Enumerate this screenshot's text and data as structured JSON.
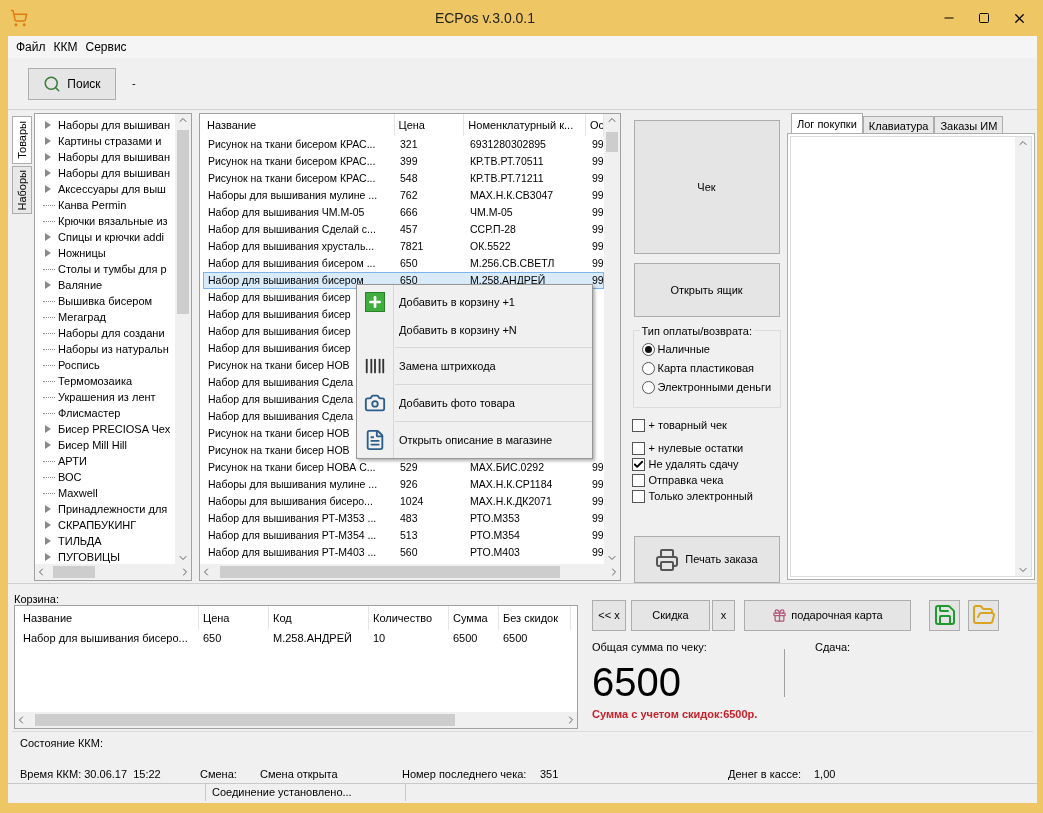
{
  "window": {
    "title": "ECPos v.3.0.0.1"
  },
  "menu": [
    "Файл",
    "ККМ",
    "Сервис"
  ],
  "toolbar": {
    "search_button": "Поиск",
    "status": "-"
  },
  "side_tabs": [
    {
      "label": "Товары",
      "selected": true
    },
    {
      "label": "Наборы",
      "selected": false
    }
  ],
  "tree": [
    {
      "label": "Наборы для вышиван",
      "kind": "branch"
    },
    {
      "label": "Картины стразами и",
      "kind": "branch"
    },
    {
      "label": "Наборы для вышиван",
      "kind": "branch"
    },
    {
      "label": "Наборы для вышиван",
      "kind": "branch"
    },
    {
      "label": "Аксессуары для выш",
      "kind": "branch"
    },
    {
      "label": "Канва Permin",
      "kind": "leaf"
    },
    {
      "label": "Крючки вязальные из",
      "kind": "leaf"
    },
    {
      "label": "Спицы и крючки addi",
      "kind": "branch"
    },
    {
      "label": "Ножницы",
      "kind": "branch"
    },
    {
      "label": "Столы и тумбы для р",
      "kind": "leaf"
    },
    {
      "label": "Валяние",
      "kind": "branch"
    },
    {
      "label": "Вышивка бисером",
      "kind": "leaf"
    },
    {
      "label": "Мегаград",
      "kind": "leaf"
    },
    {
      "label": "Наборы для создани",
      "kind": "leaf"
    },
    {
      "label": "Наборы из натуральн",
      "kind": "leaf"
    },
    {
      "label": "Роспись",
      "kind": "leaf"
    },
    {
      "label": "Термомозаика",
      "kind": "leaf"
    },
    {
      "label": "Украшения из лент",
      "kind": "leaf"
    },
    {
      "label": "Флисмастер",
      "kind": "leaf"
    },
    {
      "label": "Бисер PRECIOSA Чех",
      "kind": "branch"
    },
    {
      "label": "Бисер Mill Hill",
      "kind": "branch"
    },
    {
      "label": "АРТИ",
      "kind": "leaf"
    },
    {
      "label": "ВОС",
      "kind": "leaf"
    },
    {
      "label": "Maxwell",
      "kind": "leaf"
    },
    {
      "label": "Принадлежности для",
      "kind": "branch"
    },
    {
      "label": "СКРАПБУКИНГ",
      "kind": "branch"
    },
    {
      "label": "ТИЛЬДА",
      "kind": "branch"
    },
    {
      "label": "ПУГОВИЦЫ",
      "kind": "branch"
    }
  ],
  "products": {
    "columns": [
      "Название",
      "Цена",
      "Номенклатурный к...",
      "Ос"
    ],
    "rows": [
      {
        "name": "Рисунок на ткани бисером КРАС...",
        "price": "321",
        "code": "6931280302895",
        "stock": "99",
        "selected": false
      },
      {
        "name": "Рисунок на ткани бисером КРАС...",
        "price": "399",
        "code": "КР.ТВ.РТ.70511",
        "stock": "99",
        "selected": false
      },
      {
        "name": "Рисунок на ткани бисером КРАС...",
        "price": "548",
        "code": "КР.ТВ.РТ.71211",
        "stock": "99",
        "selected": false
      },
      {
        "name": "Наборы для вышивания мулине ...",
        "price": "762",
        "code": "МАХ.Н.К.СВ3047",
        "stock": "99",
        "selected": false
      },
      {
        "name": "Набор для вышивания  ЧМ.М-05",
        "price": "666",
        "code": "ЧМ.М-05",
        "stock": "99",
        "selected": false
      },
      {
        "name": "Набор для вышивания Сделай с...",
        "price": "457",
        "code": "ССР.П-28",
        "stock": "99",
        "selected": false
      },
      {
        "name": "Набор для вышивания хрусталь...",
        "price": "7821",
        "code": "ОК.5522",
        "stock": "99",
        "selected": false
      },
      {
        "name": "Набор для вышивания бисером ...",
        "price": "650",
        "code": "М.256.СВ.СВЕТЛ",
        "stock": "99",
        "selected": false
      },
      {
        "name": "Набор для вышивания бисером",
        "price": "650",
        "code": "М.258.АНДРЕЙ",
        "stock": "99",
        "selected": true
      },
      {
        "name": "Набор для вышивания бисер",
        "selected": false
      },
      {
        "name": "Набор для вышивания бисер",
        "selected": false
      },
      {
        "name": "Набор для вышивания бисер",
        "selected": false
      },
      {
        "name": "Набор для вышивания бисер",
        "selected": false
      },
      {
        "name": "Рисунок на ткани бисер НОВ",
        "selected": false
      },
      {
        "name": "Набор для вышивания Сдела",
        "selected": false
      },
      {
        "name": "Набор для вышивания Сдела",
        "selected": false
      },
      {
        "name": "Набор для вышивания Сдела",
        "selected": false
      },
      {
        "name": "Рисунок на ткани бисер НОВ",
        "selected": false
      },
      {
        "name": "Рисунок на ткани бисер НОВ",
        "selected": false
      },
      {
        "name": "Рисунок на ткани бисер НОВА С...",
        "price": "529",
        "code": "МАХ.БИС.0292",
        "stock": "99",
        "selected": false
      },
      {
        "name": "Наборы для вышивания мулине ...",
        "price": "926",
        "code": "МАХ.Н.К.СР1184",
        "stock": "99",
        "selected": false
      },
      {
        "name": "Наборы для вышивания бисеро...",
        "price": "1024",
        "code": "МАХ.Н.К.ДК2071",
        "stock": "99",
        "selected": false
      },
      {
        "name": "Набор для вышивания  РТ-М353 ...",
        "price": "483",
        "code": "РТО.М353",
        "stock": "99",
        "selected": false
      },
      {
        "name": "Набор для вышивания  РТ-М354 ...",
        "price": "513",
        "code": "РТО.М354",
        "stock": "99",
        "selected": false
      },
      {
        "name": "Набор для вышивания  РТ-М403 ...",
        "price": "560",
        "code": "РТО.М403",
        "stock": "99",
        "selected": false
      }
    ]
  },
  "context_menu": [
    {
      "label": "Добавить в корзину +1",
      "kind": "plus",
      "separator_before": false
    },
    {
      "label": "Добавить в корзину +N",
      "kind": "none",
      "separator_before": false
    },
    {
      "label": "Замена штрихкода",
      "kind": "barcode",
      "separator_before": true
    },
    {
      "label": "Добавить фото товара",
      "kind": "camera",
      "separator_before": true
    },
    {
      "label": "Открыть описание в магазине",
      "kind": "document",
      "separator_before": true
    }
  ],
  "actions": {
    "receipt_button": "Чек",
    "drawer_button": "Открыть ящик",
    "print_button": "Печать заказа"
  },
  "payment": {
    "title": "Тип оплаты/возврата:",
    "options": [
      {
        "label": "Наличные",
        "selected": true
      },
      {
        "label": "Карта пластиковая",
        "selected": false
      },
      {
        "label": "Электронными деньги",
        "selected": false
      }
    ]
  },
  "options": [
    {
      "label": "+ товарный чек",
      "checked": false
    },
    {
      "label": "+ нулевые остатки",
      "checked": false
    },
    {
      "label": "Не удалять сдачу",
      "checked": true
    },
    {
      "label": "Отправка чека",
      "checked": false
    },
    {
      "label": "Только электронный",
      "checked": false
    }
  ],
  "log_tabs": [
    {
      "label": "Лог покупки",
      "selected": true
    },
    {
      "label": "Клавиатура",
      "selected": false
    },
    {
      "label": "Заказы ИМ",
      "selected": false
    }
  ],
  "basket": {
    "title": "Корзина:",
    "columns": [
      "Название",
      "Цена",
      "Код",
      "Количество",
      "Сумма",
      "Без скидок"
    ],
    "rows": [
      [
        "Набор для вышивания бисеро...",
        "650",
        "М.258.АНДРЕЙ",
        "10",
        "6500",
        "6500"
      ]
    ]
  },
  "discount": {
    "back_button": "<< x",
    "discount_button": "Скидка",
    "clear_button": "x",
    "gift_card_button": "подарочная карта"
  },
  "totals": {
    "total_label": "Общая сумма по чеку:",
    "total": "6500",
    "change_label": "Сдача:",
    "discounted": "Сумма с учетом скидок:6500р."
  },
  "kkm": {
    "title": "Состояние ККМ:",
    "time": "Время ККМ: 30.06.17  15:22",
    "shift_label": "Смена:",
    "shift": "Смена открыта",
    "last_receipt_label": "Номер последнего чека:",
    "last_receipt": "351",
    "cash_label": "Денег в кассе:",
    "cash": "1,00"
  },
  "status_bar": [
    "Соединение установлено..."
  ]
}
